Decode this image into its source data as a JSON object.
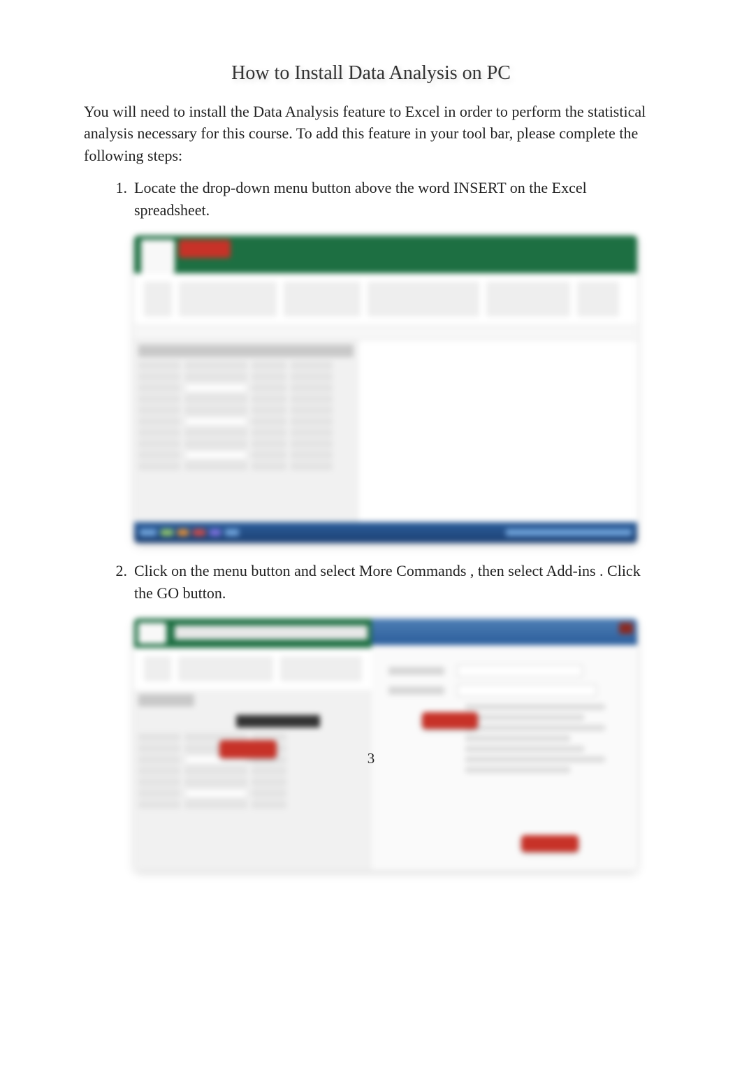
{
  "title": "How to Install Data Analysis on PC",
  "intro": "You will need to install the Data Analysis feature to Excel in order to perform the statistical analysis necessary for this course. To add this feature in your tool bar, please complete the following steps:",
  "steps": [
    {
      "marker": "1.",
      "text": "Locate the drop-down menu button above the word INSERT on the Excel spreadsheet."
    },
    {
      "marker": "2.",
      "prefix": "Click on the menu button and select ",
      "emph1": "More Commands",
      "mid1": ", then select ",
      "emph2": "Add-ins",
      "mid2": ". Click the",
      "emph3": "GO",
      "suffix": " button."
    }
  ],
  "page_number": "3"
}
